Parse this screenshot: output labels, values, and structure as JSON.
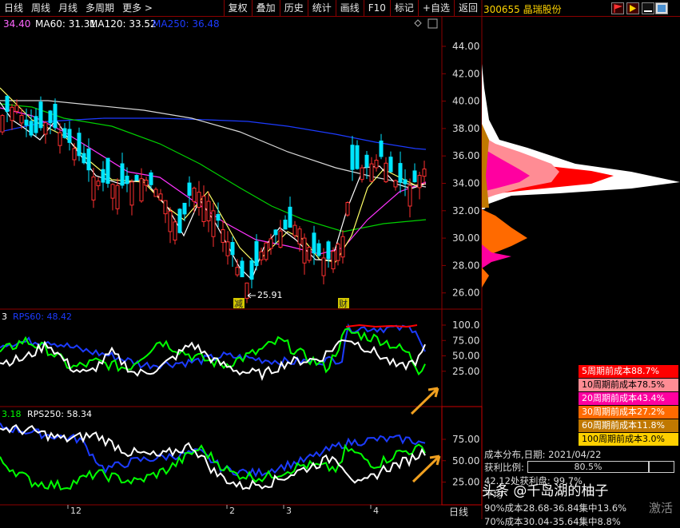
{
  "toolbar": {
    "left": [
      "日线",
      "周线",
      "月线",
      "多周期",
      "更多 >"
    ],
    "right": [
      "复权",
      "叠加",
      "历史",
      "统计",
      "画线",
      "F10",
      "标记",
      "+自选",
      "返回"
    ]
  },
  "stock": {
    "code": "300655 晶瑞股份"
  },
  "ma_legend": {
    "ma_first": "34.40",
    "ma60": "MA60: 31.31",
    "ma120": "MA120: 33.52",
    "ma250": "MA250: 36.48"
  },
  "price_axis": [
    "44.00",
    "42.00",
    "40.00",
    "38.00",
    "36.00",
    "34.00",
    "32.00",
    "30.00",
    "28.00",
    "26.00"
  ],
  "annotations": {
    "low": "25.91",
    "mark1": "减",
    "mark2": "财"
  },
  "rps60": {
    "prefix": "3",
    "label": "RPS60: 48.42",
    "axis": [
      "100.0",
      "75.00",
      "50.00",
      "25.00"
    ]
  },
  "rps250": {
    "prefix": "3.18",
    "label": "RPS250: 58.34",
    "axis": [
      "75.00",
      "50.00",
      "25.00"
    ]
  },
  "x_axis": [
    "12",
    "2",
    "3",
    "4"
  ],
  "period_label": "日线",
  "cost_legend": [
    {
      "label": "5周期前成本88.7%",
      "bg": "#ff0000",
      "fg": "#ffffff"
    },
    {
      "label": "10周期前成本78.5%",
      "bg": "#ff8c94",
      "fg": "#000000"
    },
    {
      "label": "20周期前成本43.4%",
      "bg": "#ff00a0",
      "fg": "#ffffff"
    },
    {
      "label": "30周期前成本27.2%",
      "bg": "#ff6a00",
      "fg": "#ffffff"
    },
    {
      "label": "60周期前成本11.8%",
      "bg": "#c07800",
      "fg": "#ffffff"
    },
    {
      "label": "100周期前成本3.0%",
      "bg": "#ffd000",
      "fg": "#000000"
    }
  ],
  "cost": {
    "date_line": "成本分布,日期: 2021/04/22",
    "profit_label": "获利比例:",
    "profit_value": "80.5%",
    "profit_fraction": 0.805,
    "line1": "42.12处获利盘: 99.7%",
    "line2": "平均",
    "line3": "90%成本28.68-36.84集中13.6%",
    "line4": "70%成本30.04-35.64集中8.8%"
  },
  "watermark": "头条 @千岛湖的柚子",
  "activate_text": "激活",
  "colors": {
    "up": "#ff3030",
    "down": "#00e5ff",
    "ma250": "#1c3bff",
    "ma120": "#d8d8d8",
    "ma60": "#00d000",
    "ma20": "#ff00ff",
    "ma10": "#ffff66",
    "grid": "#8b0000"
  }
}
